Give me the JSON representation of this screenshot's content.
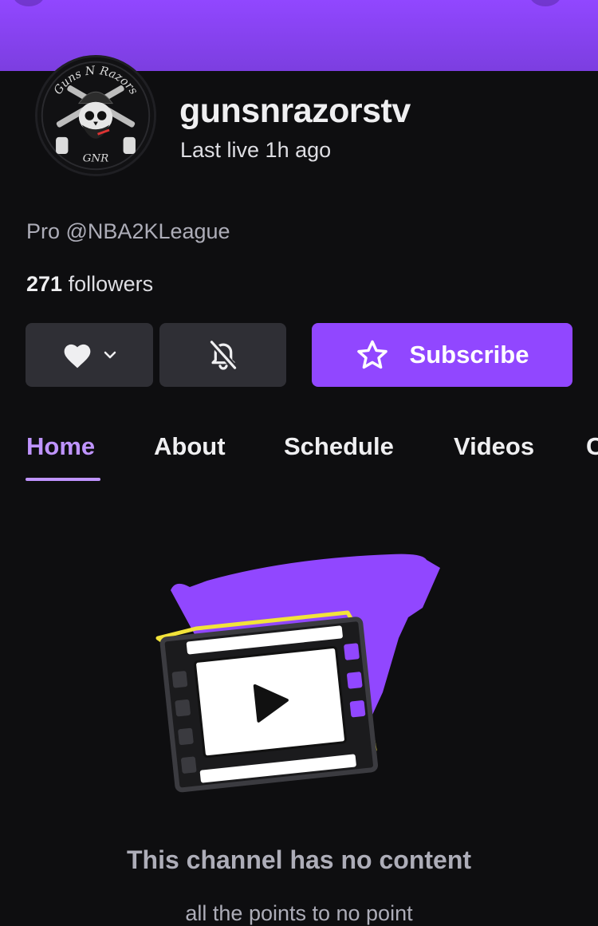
{
  "channel": {
    "name": "gunsnrazorstv",
    "last_live": "Last live 1h ago",
    "bio": "Pro @NBA2KLeague",
    "followers_count": "271",
    "followers_label": "followers",
    "avatar_text_top": "Guns N Razors",
    "avatar_text_bottom": "GNR"
  },
  "actions": {
    "follow_icon": "heart-icon",
    "follow_menu_icon": "chevron-down-icon",
    "notify_icon": "bell-off-icon",
    "subscribe_icon": "star-icon",
    "subscribe_label": "Subscribe"
  },
  "tabs": [
    {
      "label": "Home",
      "active": true
    },
    {
      "label": "About",
      "active": false
    },
    {
      "label": "Schedule",
      "active": false
    },
    {
      "label": "Videos",
      "active": false
    },
    {
      "label": "C",
      "active": false
    }
  ],
  "empty_state": {
    "icon": "film-play-illustration",
    "title": "This channel has no content",
    "subtitle": "all the points to no point"
  },
  "colors": {
    "brand_purple": "#9147ff",
    "active_tab": "#bf94ff",
    "background": "#0e0e10",
    "button_gray": "#2f2f35",
    "film_outline_yellow": "#f2e33a"
  }
}
